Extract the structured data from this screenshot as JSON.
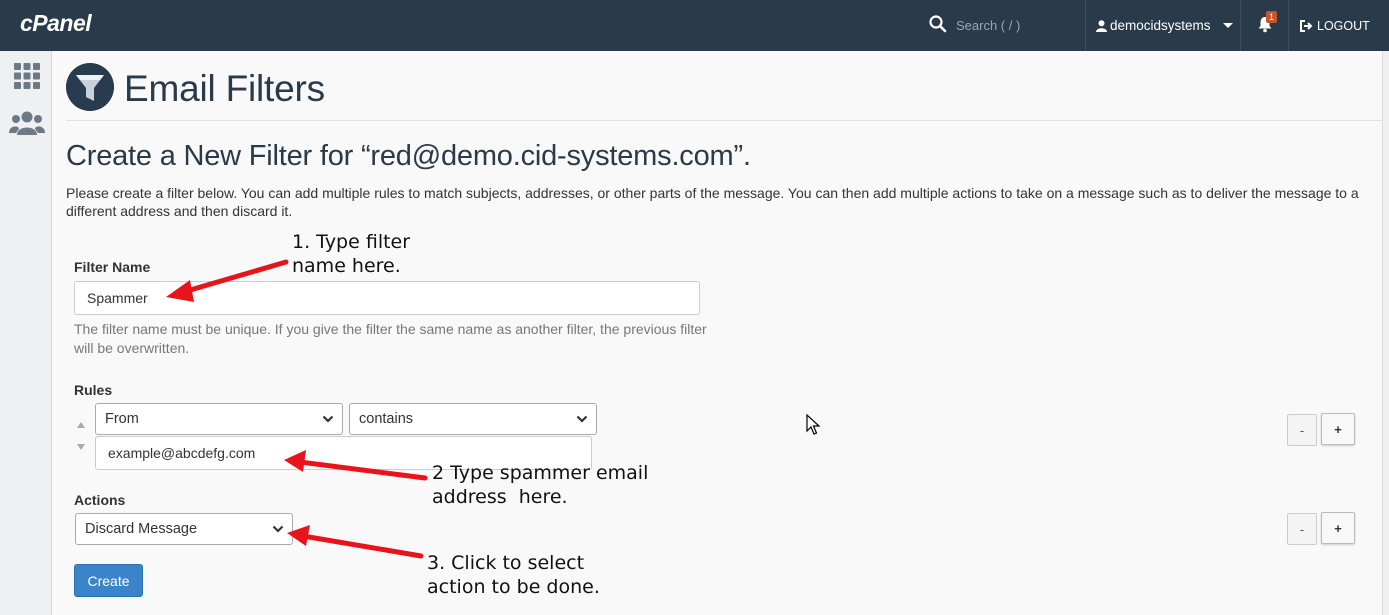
{
  "topbar": {
    "logo": "cPanel",
    "search_placeholder": "Search ( / )",
    "username": "democidsystems",
    "notification_count": "1",
    "logout_label": "LOGOUT"
  },
  "page": {
    "title": "Email Filters",
    "subtitle": "Create a New Filter for “red@demo.cid-systems.com”.",
    "intro": "Please create a filter below. You can add multiple rules to match subjects, addresses, or other parts of the message. You can then add multiple actions to take on a message such as to deliver the message to a different address and then discard it."
  },
  "form": {
    "filter_name_label": "Filter Name",
    "filter_name_value": "Spammer",
    "filter_name_help": "The filter name must be unique. If you give the filter the same name as another filter, the previous filter will be overwritten.",
    "rules_label": "Rules",
    "rule_part": "From",
    "rule_match": "contains",
    "rule_value": "example@abcdefg.com",
    "actions_label": "Actions",
    "action_value": "Discard Message",
    "minus_label": "-",
    "plus_label": "+",
    "create_label": "Create"
  },
  "annotations": {
    "step1": "1. Type filter\nname here.",
    "step2": "2 Type spammer email\naddress  here.",
    "step3": "3. Click to select\naction to be done."
  },
  "colors": {
    "topbar": "#293a4a",
    "primary_button": "#3a85c9",
    "annotation_arrow": "#e8141c"
  }
}
